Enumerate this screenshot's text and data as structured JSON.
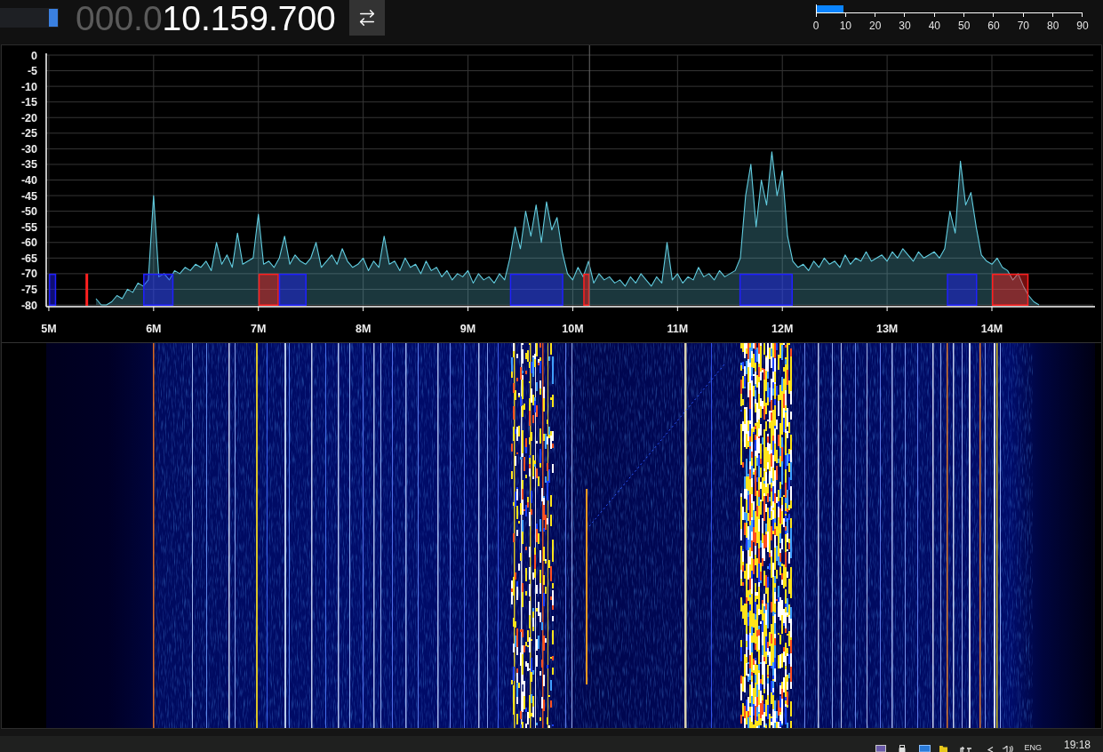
{
  "top_bar": {
    "slider": {
      "level": 1
    },
    "frequency": {
      "leading_zeros": "000.0",
      "digits": "10.159.700"
    },
    "meter": {
      "level": 0.1,
      "ticks": [
        "0",
        "10",
        "20",
        "30",
        "40",
        "50",
        "60",
        "70",
        "80",
        "90"
      ]
    }
  },
  "spectrum": {
    "chart_data": {
      "type": "area",
      "grid": true,
      "xlim": [
        4.975,
        14.967
      ],
      "ylim": [
        -80,
        0
      ],
      "xticks": [
        {
          "value": 5,
          "label": "5M"
        },
        {
          "value": 6,
          "label": "6M"
        },
        {
          "value": 7,
          "label": "7M"
        },
        {
          "value": 8,
          "label": "8M"
        },
        {
          "value": 9,
          "label": "9M"
        },
        {
          "value": 10,
          "label": "10M"
        },
        {
          "value": 11,
          "label": "11M"
        },
        {
          "value": 12,
          "label": "12M"
        },
        {
          "value": 13,
          "label": "13M"
        },
        {
          "value": 14,
          "label": "14M"
        }
      ],
      "yticks": [
        0,
        -5,
        -10,
        -15,
        -20,
        -25,
        -30,
        -35,
        -40,
        -45,
        -50,
        -55,
        -60,
        -65,
        -70,
        -75,
        -80
      ],
      "x": [
        5.45,
        5.5,
        5.55,
        5.6,
        5.65,
        5.7,
        5.75,
        5.8,
        5.85,
        5.9,
        5.95,
        6,
        6.05,
        6.1,
        6.15,
        6.2,
        6.25,
        6.3,
        6.35,
        6.4,
        6.45,
        6.5,
        6.55,
        6.6,
        6.65,
        6.7,
        6.75,
        6.8,
        6.85,
        6.9,
        6.95,
        7,
        7.05,
        7.1,
        7.15,
        7.2,
        7.25,
        7.3,
        7.35,
        7.4,
        7.45,
        7.5,
        7.55,
        7.6,
        7.65,
        7.7,
        7.75,
        7.8,
        7.85,
        7.9,
        7.95,
        8,
        8.05,
        8.1,
        8.15,
        8.2,
        8.25,
        8.3,
        8.35,
        8.4,
        8.45,
        8.5,
        8.55,
        8.6,
        8.65,
        8.7,
        8.75,
        8.8,
        8.85,
        8.9,
        8.95,
        9,
        9.05,
        9.1,
        9.15,
        9.2,
        9.25,
        9.3,
        9.35,
        9.4,
        9.45,
        9.5,
        9.55,
        9.6,
        9.65,
        9.7,
        9.75,
        9.8,
        9.85,
        9.9,
        9.95,
        10,
        10.05,
        10.1,
        10.15,
        10.2,
        10.25,
        10.3,
        10.35,
        10.4,
        10.45,
        10.5,
        10.55,
        10.6,
        10.65,
        10.7,
        10.75,
        10.8,
        10.85,
        10.9,
        10.95,
        11,
        11.05,
        11.1,
        11.15,
        11.2,
        11.25,
        11.3,
        11.35,
        11.4,
        11.45,
        11.5,
        11.55,
        11.6,
        11.65,
        11.7,
        11.75,
        11.8,
        11.85,
        11.9,
        11.95,
        12,
        12.05,
        12.1,
        12.15,
        12.2,
        12.25,
        12.3,
        12.35,
        12.4,
        12.45,
        12.5,
        12.55,
        12.6,
        12.65,
        12.7,
        12.75,
        12.8,
        12.85,
        12.9,
        12.95,
        13,
        13.05,
        13.1,
        13.15,
        13.2,
        13.25,
        13.3,
        13.35,
        13.4,
        13.45,
        13.5,
        13.55,
        13.6,
        13.65,
        13.7,
        13.75,
        13.8,
        13.85,
        13.9,
        13.95,
        14,
        14.05,
        14.1,
        14.15,
        14.2,
        14.25,
        14.3,
        14.35,
        14.4,
        14.45
      ],
      "series": [
        {
          "color": "#62cde0",
          "values": [
            -78,
            -80,
            -80,
            -79,
            -77,
            -78,
            -75,
            -76,
            -73,
            -74,
            -72,
            -45,
            -71,
            -70,
            -72,
            -69,
            -70,
            -68,
            -69,
            -67,
            -68,
            -66,
            -69,
            -60,
            -67,
            -64,
            -68,
            -57,
            -67,
            -66,
            -65,
            -51,
            -67,
            -66,
            -68,
            -65,
            -58,
            -67,
            -64,
            -66,
            -67,
            -65,
            -60,
            -68,
            -66,
            -64,
            -67,
            -62,
            -66,
            -68,
            -67,
            -65,
            -69,
            -66,
            -68,
            -58,
            -67,
            -66,
            -69,
            -65,
            -68,
            -67,
            -70,
            -66,
            -69,
            -68,
            -71,
            -69,
            -72,
            -70,
            -71,
            -69,
            -73,
            -70,
            -72,
            -71,
            -73,
            -70,
            -72,
            -65,
            -55,
            -62,
            -50,
            -58,
            -48,
            -60,
            -47,
            -56,
            -52,
            -63,
            -70,
            -72,
            -68,
            -71,
            -66,
            -73,
            -70,
            -72,
            -71,
            -73,
            -72,
            -74,
            -71,
            -73,
            -70,
            -72,
            -74,
            -71,
            -73,
            -60,
            -72,
            -70,
            -73,
            -71,
            -72,
            -68,
            -71,
            -70,
            -72,
            -69,
            -71,
            -70,
            -69,
            -65,
            -45,
            -35,
            -55,
            -40,
            -48,
            -31,
            -45,
            -37,
            -58,
            -66,
            -68,
            -67,
            -69,
            -66,
            -68,
            -65,
            -67,
            -66,
            -68,
            -64,
            -67,
            -65,
            -66,
            -63,
            -66,
            -65,
            -64,
            -66,
            -63,
            -65,
            -62,
            -64,
            -66,
            -63,
            -65,
            -64,
            -63,
            -65,
            -62,
            -50,
            -57,
            -34,
            -48,
            -44,
            -55,
            -64,
            -66,
            -67,
            -65,
            -68,
            -69,
            -72,
            -70,
            -74,
            -77,
            -79,
            -80
          ]
        }
      ],
      "bands": [
        {
          "axis": "x",
          "from": 5.0,
          "to": 5.07,
          "color": "#2020ff"
        },
        {
          "axis": "x",
          "from": 5.35,
          "to": 5.375,
          "color": "#ff2020"
        },
        {
          "axis": "x",
          "from": 5.9,
          "to": 6.19,
          "color": "#2020ff"
        },
        {
          "axis": "x",
          "from": 7.0,
          "to": 7.195,
          "color": "#ff2020"
        },
        {
          "axis": "x",
          "from": 7.195,
          "to": 7.46,
          "color": "#2020ff"
        },
        {
          "axis": "x",
          "from": 9.4,
          "to": 9.91,
          "color": "#2020ff"
        },
        {
          "axis": "x",
          "from": 10.1,
          "to": 10.16,
          "color": "#ff2020"
        },
        {
          "axis": "x",
          "from": 11.59,
          "to": 12.1,
          "color": "#2020ff"
        },
        {
          "axis": "x",
          "from": 13.57,
          "to": 13.86,
          "color": "#2020ff"
        },
        {
          "axis": "x",
          "from": 14.0,
          "to": 14.35,
          "color": "#ff2020"
        }
      ],
      "ref_lines": [
        {
          "axis": "x",
          "value": 10.1597
        }
      ]
    }
  },
  "taskbar": {
    "language": "ENG",
    "clock": "19:18"
  }
}
